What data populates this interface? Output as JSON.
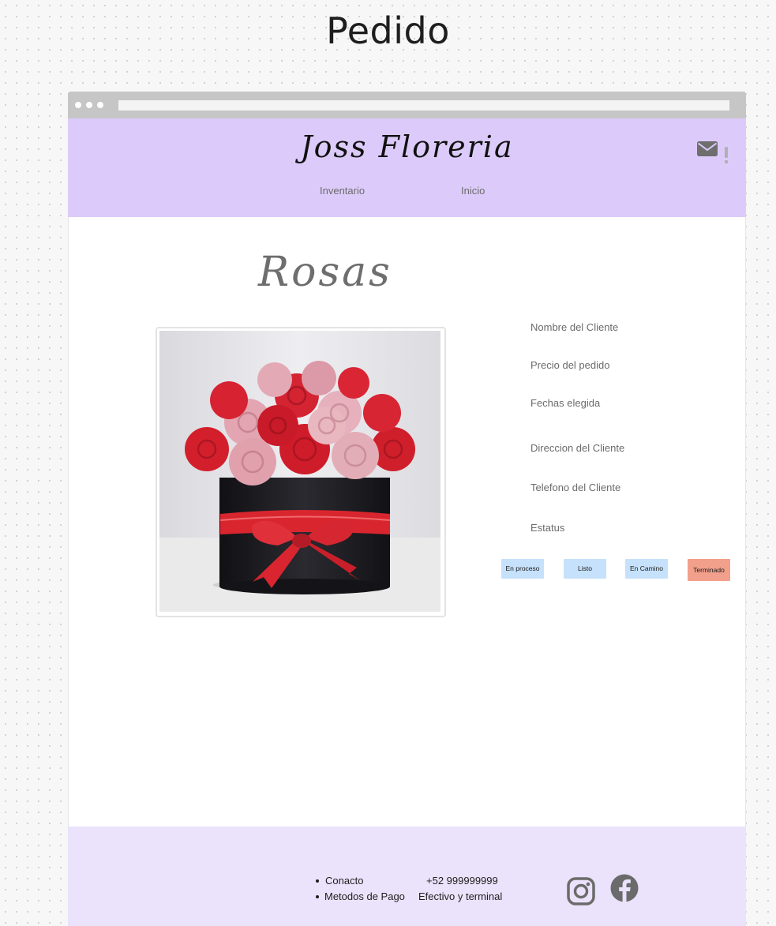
{
  "board": {
    "title": "Pedido"
  },
  "header": {
    "brand": "Joss Floreria",
    "nav": [
      {
        "label": "Inventario"
      },
      {
        "label": "Inicio"
      }
    ],
    "icons": {
      "mail": "envelope-icon",
      "alert": "exclamation-icon"
    }
  },
  "product": {
    "title": "Rosas",
    "image": "rose-arrangement-photo",
    "fields": [
      {
        "label": "Nombre del Cliente"
      },
      {
        "label": "Precio del pedido"
      },
      {
        "label": "Fechas elegida"
      },
      {
        "label": "Direccion del Cliente"
      },
      {
        "label": "Telefono del Cliente"
      },
      {
        "label": "Estatus"
      }
    ],
    "status_options": [
      {
        "label": "En proceso",
        "color": "#c6e1fb"
      },
      {
        "label": "Listo",
        "color": "#c6e1fb"
      },
      {
        "label": "En Camino",
        "color": "#c6e1fb"
      },
      {
        "label": "Terminado",
        "color": "#f2a08b"
      }
    ]
  },
  "footer": {
    "items": [
      {
        "label": "Conacto",
        "value": "+52 999999999"
      },
      {
        "label": "Metodos de Pago",
        "value": "Efectivo y terminal"
      }
    ],
    "social": [
      "instagram-icon",
      "facebook-icon"
    ]
  },
  "colors": {
    "header_bg": "#dccbfa",
    "footer_bg": "#ebe2fb",
    "status_default": "#c6e1fb",
    "status_active": "#f2a08b"
  }
}
